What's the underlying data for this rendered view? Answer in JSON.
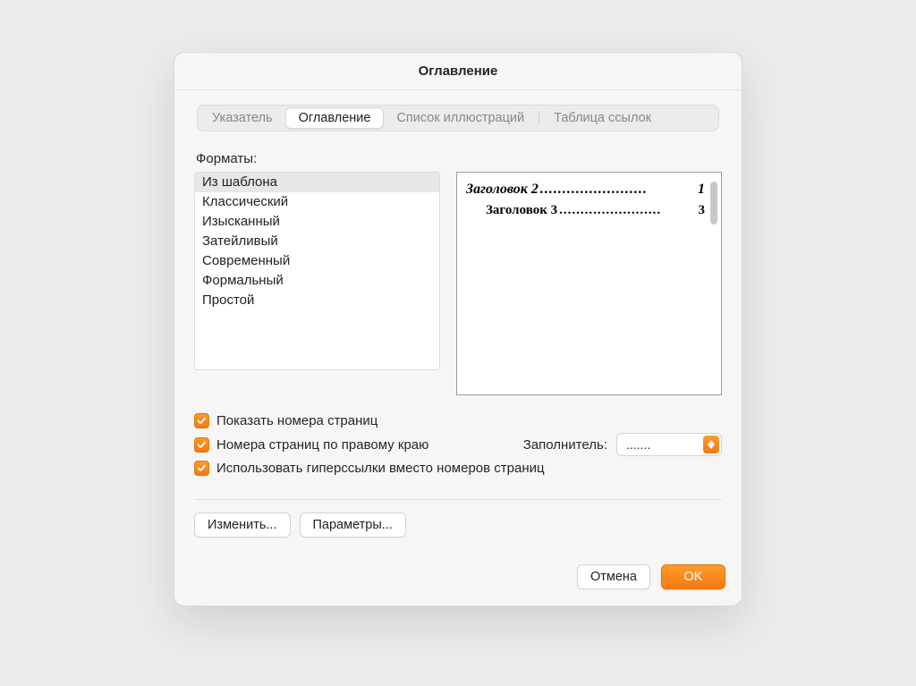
{
  "dialog": {
    "title": "Оглавление"
  },
  "tabs": {
    "index": "Указатель",
    "toc": "Оглавление",
    "figures": "Список иллюстраций",
    "authorities": "Таблица ссылок"
  },
  "formats": {
    "label": "Форматы:",
    "items": [
      "Из шаблона",
      "Классический",
      "Изысканный",
      "Затейливый",
      "Современный",
      "Формальный",
      "Простой"
    ],
    "selected_index": 0
  },
  "preview": {
    "h2_text": "Заголовок 2",
    "h2_page": "1",
    "h3_text": "Заголовок 3",
    "h3_page": "3",
    "dots": "........................"
  },
  "options": {
    "show_page_numbers": "Показать номера страниц",
    "right_align_page_numbers": "Номера страниц по правому краю",
    "use_hyperlinks": "Использовать гиперссылки вместо номеров страниц",
    "leader_label": "Заполнитель:",
    "leader_value": "......."
  },
  "buttons": {
    "modify": "Изменить...",
    "options": "Параметры...",
    "cancel": "Отмена",
    "ok": "OK"
  }
}
